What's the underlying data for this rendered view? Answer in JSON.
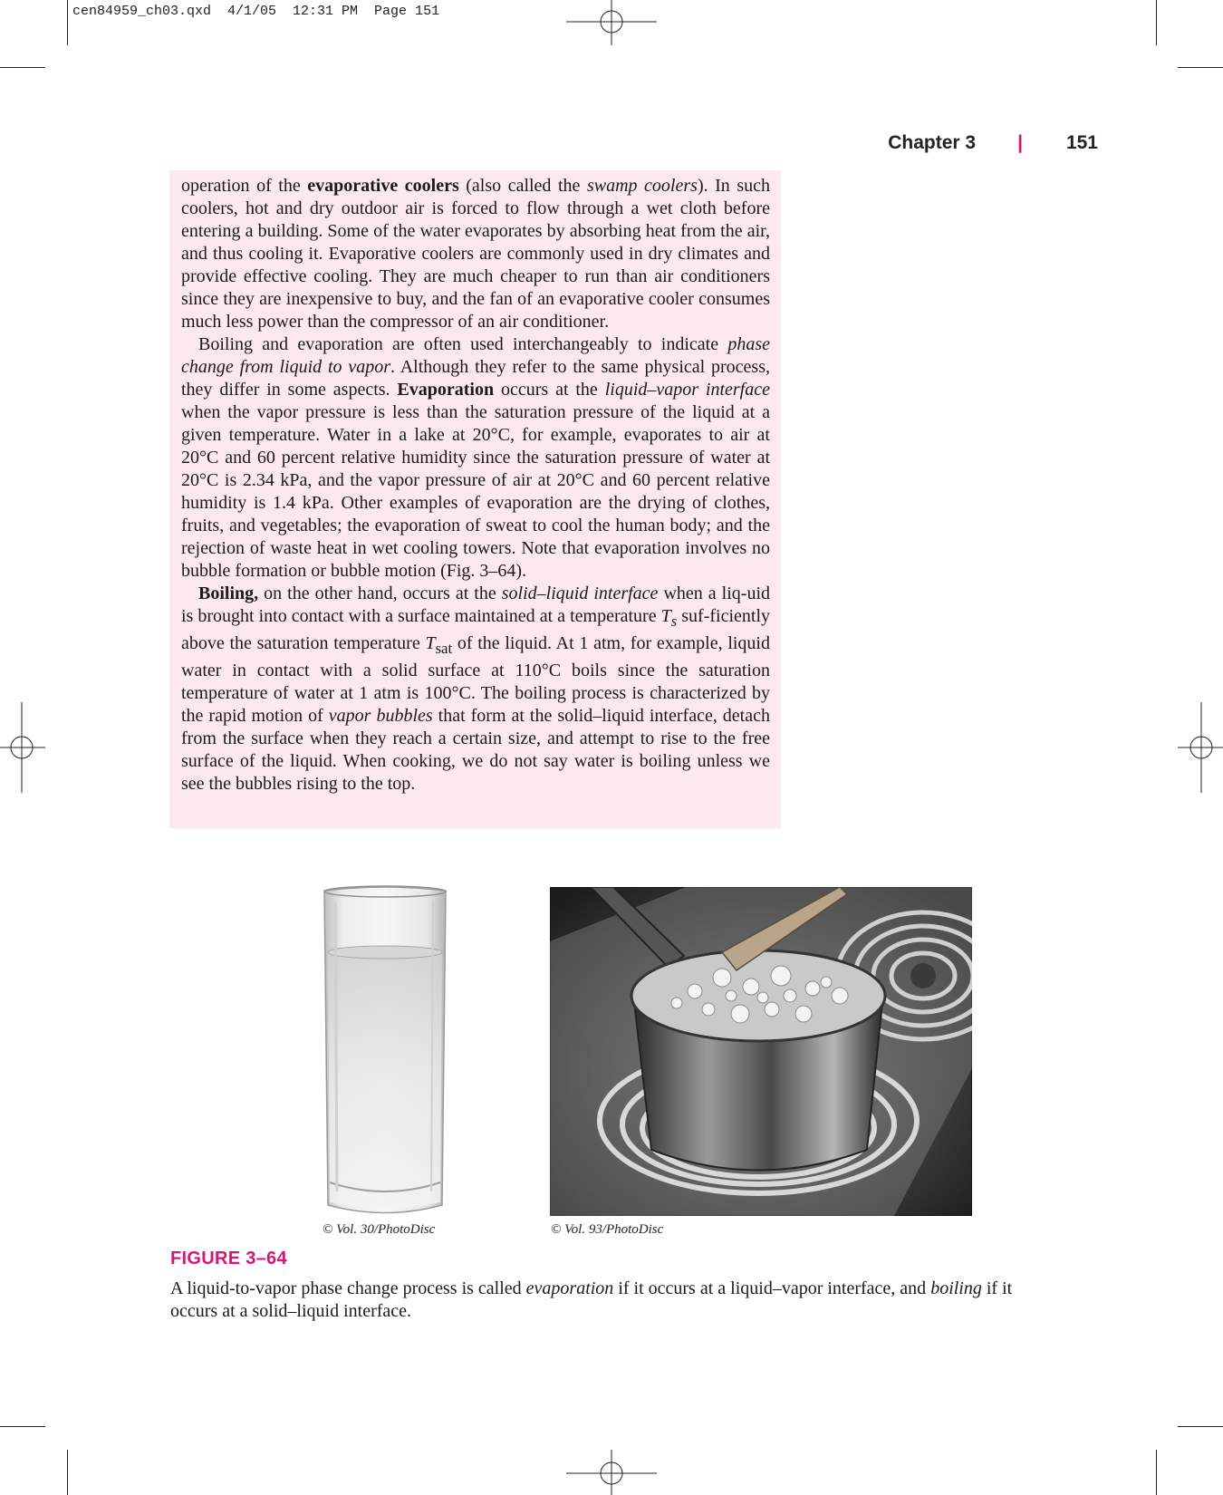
{
  "slug": "cen84959_ch03.qxd  4/1/05  12:31 PM  Page 151",
  "running_head": {
    "chapter": "Chapter 3",
    "separator": "|",
    "page_number": "151"
  },
  "body": {
    "p1": {
      "a": "operation of the ",
      "b_bold": "evaporative coolers",
      "c": " (also called the ",
      "d_italic": "swamp coolers",
      "e": "). In such coolers, hot and dry outdoor air is forced to flow through a wet cloth before entering a building. Some of the water evaporates by absorbing heat from the air, and thus cooling it. Evaporative coolers are commonly used in dry climates and provide effective cooling. They are much cheaper to run than air conditioners since they are inexpensive to buy, and the fan of an evaporative cooler consumes much less power than the compressor of an air conditioner."
    },
    "p2": {
      "a": "Boiling and evaporation are often used interchangeably to indicate ",
      "b_italic": "phase change from liquid to vapor",
      "c": ". Although they refer to the same physical process, they differ in some aspects. ",
      "d_bold": "Evaporation",
      "e": " occurs at the ",
      "f_italic": "liquid–vapor interface",
      "g": " when the vapor pressure is less than the saturation pressure of the liquid at a given temperature. Water in a lake at 20°C, for example, evaporates to air at 20°C and 60 percent relative humidity since the saturation pressure of water at 20°C is 2.34 kPa, and the vapor pressure of air at 20°C and 60 percent relative humidity is 1.4 kPa. Other examples of evaporation are the drying of clothes, fruits, and vegetables; the evaporation of sweat to cool the human body; and the rejection of waste heat in wet cooling towers. Note that evaporation involves no bubble formation or bubble motion (Fig. 3–64)."
    },
    "p3": {
      "a_bold": "Boiling,",
      "b": " on the other hand, occurs at the ",
      "c_italic": "solid–liquid interface",
      "d": " when a liq-uid is brought into contact with a surface maintained at a temperature ",
      "e_T": "T",
      "e_sub": "s",
      "f": " suf-ficiently above the saturation temperature ",
      "g_T": "T",
      "g_sub": "sat",
      "h": " of the liquid. At 1 atm, for example, liquid water in contact with a solid surface at 110°C boils since the saturation temperature of water at 1 atm is 100°C. The boiling process is characterized by the rapid motion of ",
      "i_italic": "vapor bubbles",
      "j": " that form at the solid–liquid interface, detach from the surface when they reach a certain size, and attempt to rise to the free surface of the liquid. When cooking, we do not say water is boiling unless we see the bubbles rising to the top."
    }
  },
  "figure": {
    "credit_left": "© Vol. 30/PhotoDisc",
    "credit_right": "© Vol. 93/PhotoDisc",
    "label": "FIGURE 3–64",
    "caption": {
      "a": "A liquid-to-vapor phase change process is called ",
      "b_italic": "evaporation",
      "c": " if it occurs at a liquid–vapor interface, and ",
      "d_italic": "boiling",
      "e": " if it occurs at a solid–liquid interface."
    }
  },
  "colors": {
    "accent": "#d6157a",
    "box_bg": "#fde8ef"
  }
}
